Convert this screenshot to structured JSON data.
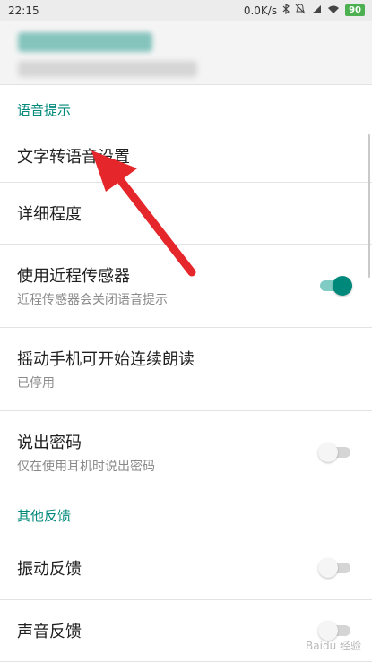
{
  "status_bar": {
    "time": "22:15",
    "network_speed": "0.0K/s",
    "battery_level": "90",
    "battery_color": "#4caf50",
    "icons": [
      "bluetooth-icon",
      "mute-icon",
      "signal-icon",
      "wifi-icon"
    ]
  },
  "theme": {
    "accent": "#00897b",
    "section_header_color": "#00897b"
  },
  "sections": {
    "voice_prompt": {
      "header": "语音提示",
      "text_to_speech": {
        "title": "文字转语音设置"
      },
      "verbosity": {
        "title": "详细程度"
      },
      "proximity_sensor": {
        "title": "使用近程传感器",
        "subtitle": "近程传感器会关闭语音提示",
        "enabled": true
      },
      "shake_to_read": {
        "title": "摇动手机可开始连续朗读",
        "subtitle": "已停用"
      },
      "speak_passwords": {
        "title": "说出密码",
        "subtitle": "仅在使用耳机时说出密码",
        "enabled": false
      }
    },
    "other_feedback": {
      "header": "其他反馈",
      "vibration": {
        "title": "振动反馈",
        "enabled": false
      },
      "sound": {
        "title": "声音反馈",
        "enabled": false
      }
    }
  },
  "watermark": "Baidu 经验"
}
